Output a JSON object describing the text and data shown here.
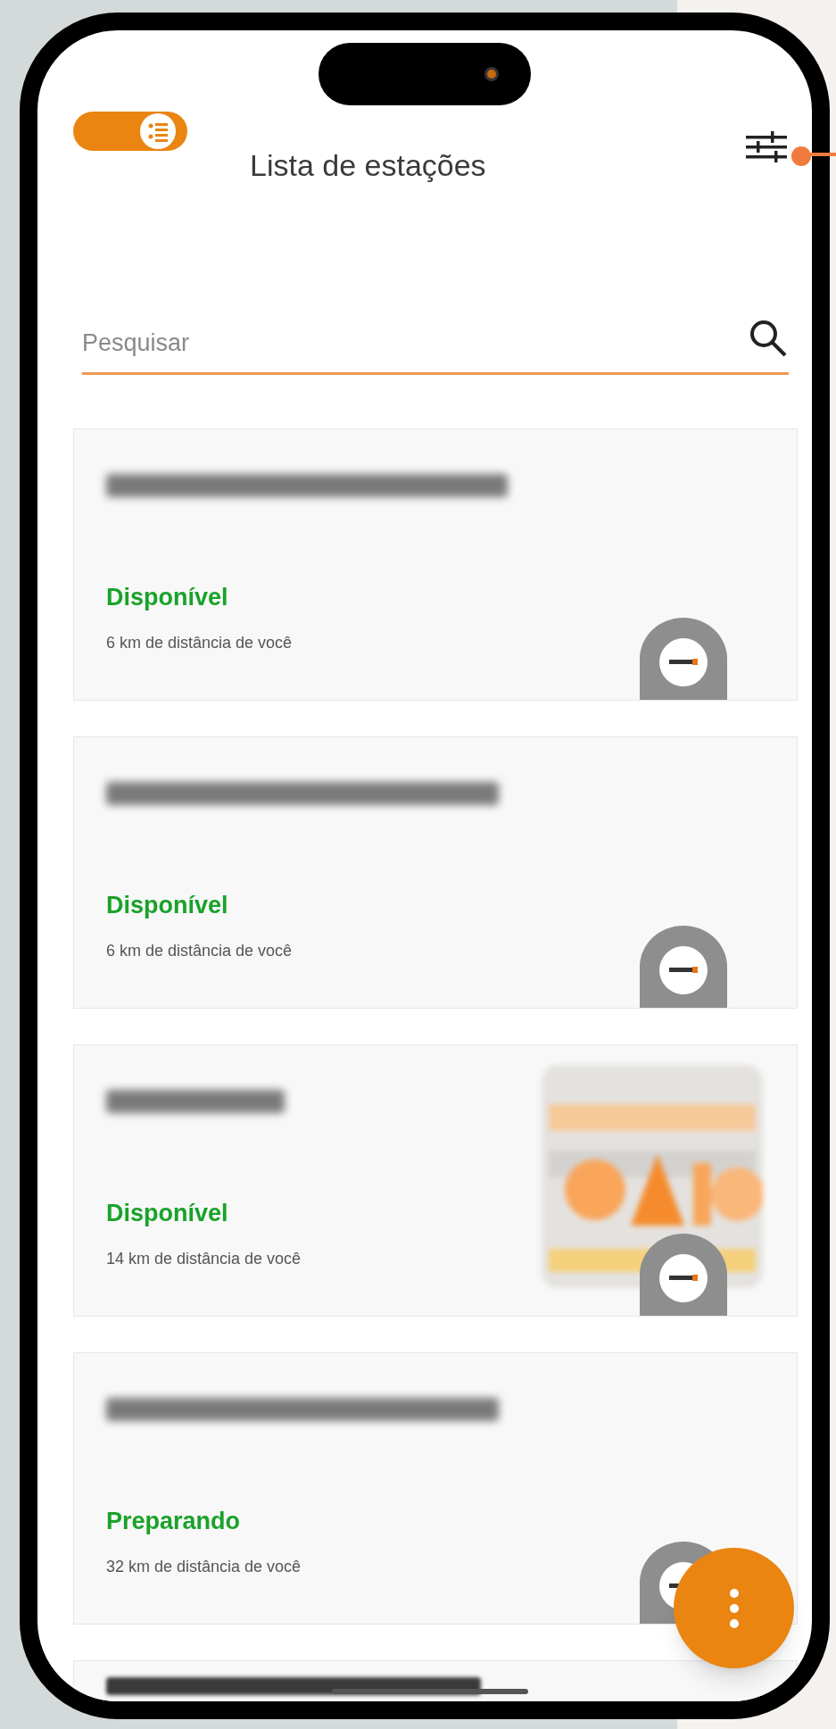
{
  "header": {
    "title": "Lista de estações",
    "view_toggle": {
      "on": true
    }
  },
  "search": {
    "placeholder": "Pesquisar"
  },
  "stations": [
    {
      "kind": "plain",
      "status": "Disponível",
      "distance": "6 km de distância de você"
    },
    {
      "kind": "plain",
      "status": "Disponível",
      "distance": "6 km de distância de você"
    },
    {
      "status": "Disponível",
      "distance": "14 km de distância de você"
    },
    {
      "kind": "plain",
      "status": "Preparando",
      "distance": "32 km de distância de você"
    },
    {
      "kind": "cut"
    }
  ]
}
